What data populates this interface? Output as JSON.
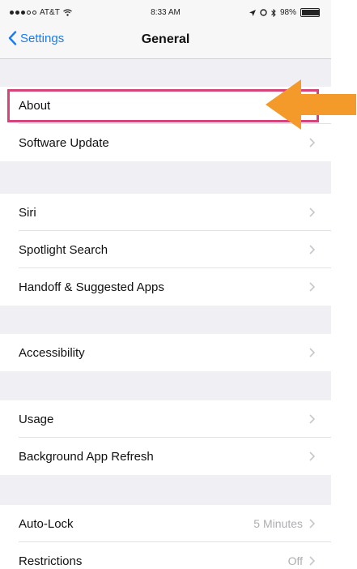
{
  "status": {
    "carrier": "AT&T",
    "time": "8:33 AM",
    "battery": "98%",
    "battery_level": 0.98
  },
  "nav": {
    "back_label": "Settings",
    "title": "General"
  },
  "groups": [
    {
      "rows": [
        {
          "label": "About"
        },
        {
          "label": "Software Update"
        }
      ]
    },
    {
      "rows": [
        {
          "label": "Siri"
        },
        {
          "label": "Spotlight Search"
        },
        {
          "label": "Handoff & Suggested Apps"
        }
      ]
    },
    {
      "rows": [
        {
          "label": "Accessibility"
        }
      ]
    },
    {
      "rows": [
        {
          "label": "Usage"
        },
        {
          "label": "Background App Refresh"
        }
      ]
    },
    {
      "rows": [
        {
          "label": "Auto-Lock",
          "value": "5 Minutes"
        },
        {
          "label": "Restrictions",
          "value": "Off"
        }
      ]
    }
  ],
  "colors": {
    "accent": "#1a7cf5",
    "highlight_box": "#d5457b",
    "arrow": "#f39a2b"
  }
}
